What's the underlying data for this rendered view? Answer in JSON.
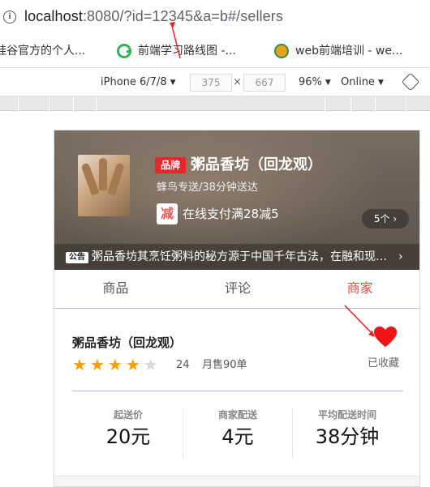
{
  "browser": {
    "url_host": "localhost",
    "url_rest": ":8080/?id=12345&a=b#/sellers",
    "bookmarks": [
      {
        "label": "硅谷官方的个人...",
        "icon": "bookmark-icon"
      },
      {
        "label": "前端学习路线图 -...",
        "icon": "g-logo-icon"
      },
      {
        "label": "web前端培训 - we...",
        "icon": "u-logo-icon"
      }
    ]
  },
  "devtools": {
    "device": "iPhone 6/7/8",
    "width": "375",
    "times": "×",
    "height": "667",
    "zoom": "96%",
    "network": "Online"
  },
  "shop": {
    "brand_badge": "品牌",
    "name": "粥品香坊（回龙观）",
    "delivery_desc": "蜂鸟专送/38分钟送达",
    "reduce_badge": "减",
    "reduce_text": "在线支付满28减5",
    "support_count": "5个 ›",
    "bulletin_badge": "公告",
    "bulletin_text": "粥品香坊其烹饪粥料的秘方源于中国千年古法，在融和现代制作工艺",
    "bulletin_arrow": "›"
  },
  "tabs": [
    {
      "label": "商品",
      "active": false
    },
    {
      "label": "评论",
      "active": false
    },
    {
      "label": "商家",
      "active": true
    }
  ],
  "seller": {
    "name": "粥品香坊（回龙观）",
    "rating": 4,
    "rating_max": 5,
    "rating_count": "24",
    "sell_count": "月售90单",
    "favorite_text": "已收藏"
  },
  "stats": [
    {
      "label": "起送价",
      "value": "20元"
    },
    {
      "label": "商家配送",
      "value": "4元"
    },
    {
      "label": "平均配送时间",
      "value": "38分钟"
    }
  ],
  "colors": {
    "active_tab": "#e04a3f",
    "star": "#ff9d00",
    "heart": "#f01414",
    "brand_badge": "#e8262c"
  }
}
